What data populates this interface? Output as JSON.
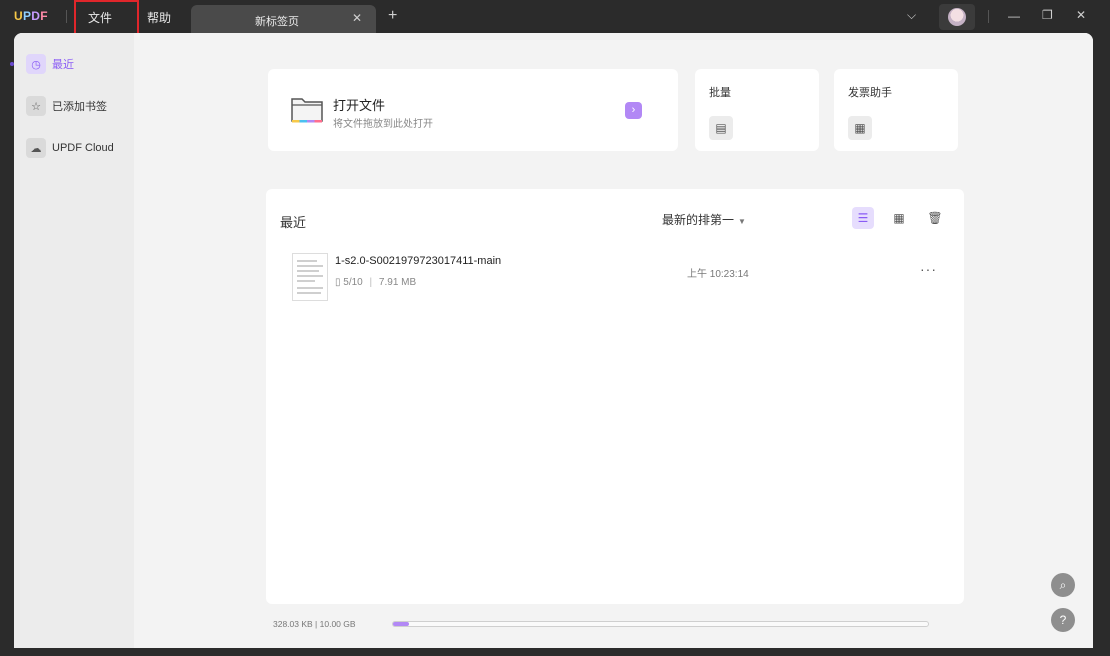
{
  "app": {
    "logo": [
      "U",
      "P",
      "D",
      "F"
    ]
  },
  "menu": {
    "file": "文件",
    "help": "帮助"
  },
  "tab": {
    "label": "新标签页",
    "close": "✕",
    "add": "+"
  },
  "window_controls": {
    "dropdown": "⌵",
    "minimize": "—",
    "restore": "❐",
    "close": "✕"
  },
  "sidebar": {
    "items": [
      {
        "label": "最近",
        "icon": "clock-icon",
        "glyph": "◷",
        "active": true
      },
      {
        "label": "已添加书签",
        "icon": "star-icon",
        "glyph": "☆",
        "active": false
      },
      {
        "label": "UPDF Cloud",
        "icon": "cloud-icon",
        "glyph": "☁",
        "active": false
      }
    ]
  },
  "open_card": {
    "title": "打开文件",
    "subtitle": "将文件拖放到此处打开",
    "arrow": "›"
  },
  "batch_card": {
    "title": "批量",
    "glyph": "▤"
  },
  "invoice_card": {
    "title": "发票助手",
    "glyph": "▦"
  },
  "recent": {
    "title": "最近",
    "sort_label": "最新的排第一",
    "sort_caret": "▼",
    "view_list_glyph": "☰",
    "view_grid_glyph": "▦",
    "trash_glyph": "🗑",
    "files": [
      {
        "name": "1-s2.0-S0021979723017411-main",
        "pages": "5/10",
        "separator": "|",
        "size": "7.91 MB",
        "time": "上午 10:23:14",
        "more": "···"
      }
    ]
  },
  "storage": {
    "text": "328.03 KB | 10.00 GB",
    "used_fraction": 0.03
  },
  "float_buttons": {
    "search": "⌕",
    "help": "?"
  },
  "colors": {
    "accent": "#8a5cf5",
    "highlight_border": "#e0262b"
  }
}
